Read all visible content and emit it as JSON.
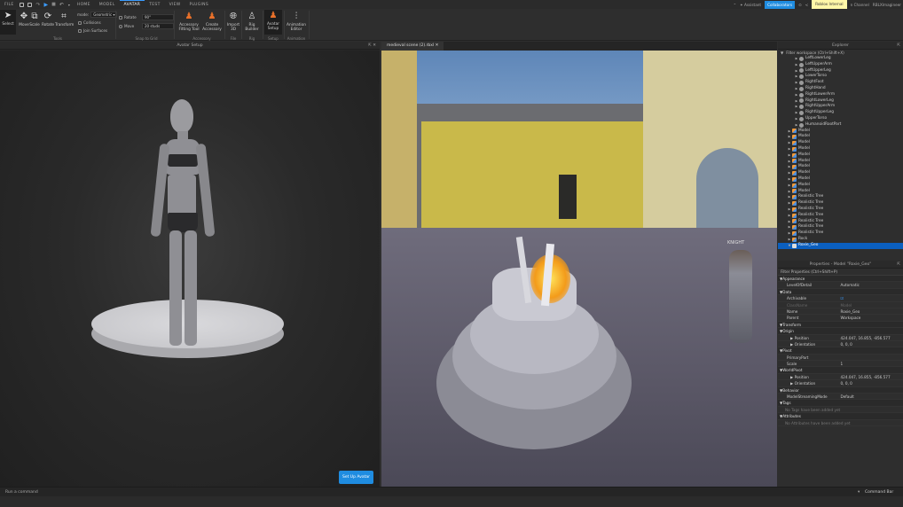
{
  "menubar": {
    "file": "FILE",
    "tabs": [
      "HOME",
      "MODEL",
      "AVATAR",
      "TEST",
      "VIEW",
      "PLUGINS"
    ],
    "active_tab": "AVATAR",
    "assistant": "Assistant",
    "collaborators": "Collaborators",
    "channel_badge": "Roblox Internal",
    "channel": "n Channel",
    "user": "RBLXImagineer"
  },
  "ribbon": {
    "tools": {
      "select": "Select",
      "move": "Move",
      "scale": "Scale",
      "rotate": "Rotate",
      "transform": "Transform",
      "mode_label": "mode:",
      "mode_value": "Geometric",
      "collisions": "Collisions",
      "join_surfaces": "Join Surfaces",
      "group": "Tools"
    },
    "snap": {
      "rotate": "Rotate",
      "rotate_value": "90°",
      "move": "Move",
      "move_value": "20 studs",
      "group": "Snap to Grid"
    },
    "accessory": {
      "fitting": "Accessory Fitting Tool",
      "create": "Create Accessory",
      "group": "Accessory"
    },
    "file": {
      "import": "Import 3D",
      "group": "File"
    },
    "rig": {
      "builder": "Rig Builder",
      "group": "Rig"
    },
    "setup": {
      "avatar_setup": "Avatar Setup",
      "group": "Setup"
    },
    "animation": {
      "editor": "Animation Editor",
      "group": "Animation"
    }
  },
  "avatar_panel": {
    "title": "Avatar Setup",
    "setup_button": "Set Up Avatar"
  },
  "viewport": {
    "tab": "medieval scene (2).rbxl",
    "nametag": "KNIGHT"
  },
  "explorer": {
    "title": "Explorer",
    "filter": "Filter workspace (Ctrl+Shift+X)",
    "items": [
      {
        "label": "LeftLowerLeg",
        "depth": 2
      },
      {
        "label": "LeftUpperArm",
        "depth": 2
      },
      {
        "label": "LeftUpperLeg",
        "depth": 2
      },
      {
        "label": "LowerTorso",
        "depth": 2
      },
      {
        "label": "RightFoot",
        "depth": 2
      },
      {
        "label": "RightHand",
        "depth": 2
      },
      {
        "label": "RightLowerArm",
        "depth": 2
      },
      {
        "label": "RightLowerLeg",
        "depth": 2
      },
      {
        "label": "RightUpperArm",
        "depth": 2
      },
      {
        "label": "RightUpperLeg",
        "depth": 2
      },
      {
        "label": "UpperTorso",
        "depth": 2
      },
      {
        "label": "HumanoidRootPart",
        "depth": 2
      },
      {
        "label": "Model",
        "depth": 1
      },
      {
        "label": "Model",
        "depth": 1
      },
      {
        "label": "Model",
        "depth": 1
      },
      {
        "label": "Model",
        "depth": 1
      },
      {
        "label": "Model",
        "depth": 1
      },
      {
        "label": "Model",
        "depth": 1
      },
      {
        "label": "Model",
        "depth": 1
      },
      {
        "label": "Model",
        "depth": 1
      },
      {
        "label": "Model",
        "depth": 1
      },
      {
        "label": "Model",
        "depth": 1
      },
      {
        "label": "Model",
        "depth": 1
      },
      {
        "label": "Realistic Tree",
        "depth": 1
      },
      {
        "label": "Realistic Tree",
        "depth": 1
      },
      {
        "label": "Realistic Tree",
        "depth": 1
      },
      {
        "label": "Realistic Tree",
        "depth": 1
      },
      {
        "label": "Realistic Tree",
        "depth": 1
      },
      {
        "label": "Realistic Tree",
        "depth": 1
      },
      {
        "label": "Realistic Tree",
        "depth": 1
      },
      {
        "label": "Rock",
        "depth": 1
      },
      {
        "label": "Roxie_Geo",
        "depth": 1,
        "selected": true
      }
    ]
  },
  "properties": {
    "title": "Properties - Model \"Roxie_Geo\"",
    "filter": "Filter Properties (Ctrl+Shift+P)",
    "rows": [
      {
        "type": "cat",
        "k": "Appearance"
      },
      {
        "k": "LevelOfDetail",
        "v": "Automatic"
      },
      {
        "type": "cat",
        "k": "Data"
      },
      {
        "k": "Archivable",
        "v": "☑"
      },
      {
        "k": "ClassName",
        "v": "Model",
        "dim": true
      },
      {
        "k": "Name",
        "v": "Roxie_Geo"
      },
      {
        "k": "Parent",
        "v": "Workspace"
      },
      {
        "type": "cat",
        "k": "Transform"
      },
      {
        "type": "cat",
        "k": "Origin"
      },
      {
        "type": "sub",
        "k": "Position",
        "v": "424.047, 16.855, -856.577"
      },
      {
        "type": "sub",
        "k": "Orientation",
        "v": "0, 0, 0"
      },
      {
        "type": "cat",
        "k": "Pivot"
      },
      {
        "k": "PrimaryPart",
        "v": ""
      },
      {
        "k": "Scale",
        "v": "1"
      },
      {
        "type": "cat",
        "k": "WorldPivot"
      },
      {
        "type": "sub",
        "k": "Position",
        "v": "424.047, 16.855, -856.577"
      },
      {
        "type": "sub",
        "k": "Orientation",
        "v": "0, 0, 0"
      },
      {
        "type": "cat",
        "k": "Behavior"
      },
      {
        "k": "ModelStreamingMode",
        "v": "Default"
      },
      {
        "type": "cat",
        "k": "Tags"
      },
      {
        "type": "empty",
        "k": "No Tags have been added yet"
      },
      {
        "type": "cat",
        "k": "Attributes"
      },
      {
        "type": "empty",
        "k": "No Attributes have been added yet"
      }
    ]
  },
  "command_bar": {
    "placeholder": "Run a command",
    "label": "Command Bar"
  },
  "colors": {
    "accent": "#1f8ce0",
    "selection": "#0b5fbf",
    "badge": "#fff7a8"
  }
}
